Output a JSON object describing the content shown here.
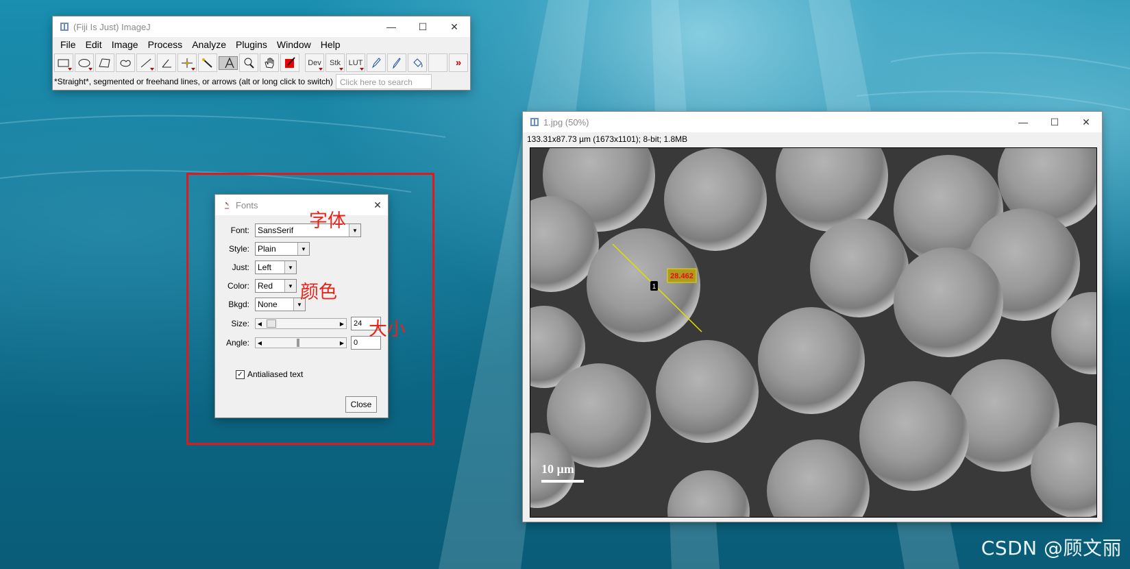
{
  "imagej": {
    "title": "(Fiji Is Just) ImageJ",
    "menu": [
      "File",
      "Edit",
      "Image",
      "Process",
      "Analyze",
      "Plugins",
      "Window",
      "Help"
    ],
    "tools": [
      "rectangle-tool",
      "oval-tool",
      "polygon-tool",
      "freehand-tool",
      "line-tool",
      "angle-tool",
      "point-tool",
      "wand-tool",
      "text-tool",
      "zoom-tool",
      "hand-tool",
      "color-picker-tool",
      "dev-tool",
      "stk-tool",
      "lut-tool",
      "pencil-tool",
      "brush-tool",
      "flood-fill-tool",
      "empty-slot",
      "more-tools"
    ],
    "tool_labels": {
      "dev": "Dev",
      "stk": "Stk",
      "lut": "LUT"
    },
    "status": "*Straight*, segmented or freehand lines, or arrows (alt or long click to switch)",
    "search_placeholder": "Click here to search"
  },
  "image_window": {
    "title": "1.jpg (50%)",
    "info": "133.31x87.73 µm (1673x1101); 8-bit; 1.8MB",
    "scale_bar": "10 µm",
    "roi_number": "1",
    "roi_text": "28.462"
  },
  "fonts_dialog": {
    "title": "Fonts",
    "font_label": "Font:",
    "font_value": "SansSerif",
    "style_label": "Style:",
    "style_value": "Plain",
    "just_label": "Just:",
    "just_value": "Left",
    "color_label": "Color:",
    "color_value": "Red",
    "bkgd_label": "Bkgd:",
    "bkgd_value": "None",
    "size_label": "Size:",
    "size_value": "24",
    "angle_label": "Angle:",
    "angle_value": "0",
    "antialiased_label": "Antialiased text",
    "antialiased_checked": true,
    "close_label": "Close"
  },
  "annotations": {
    "font": "字体",
    "color": "颜色",
    "size": "大小",
    "highlight_color": "#e1191a"
  },
  "watermark": "CSDN @顾文丽"
}
